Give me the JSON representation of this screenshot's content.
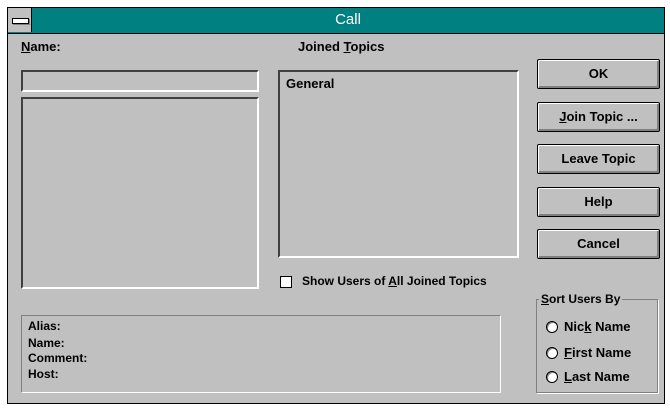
{
  "window": {
    "title": "Call"
  },
  "name_label": {
    "before": "",
    "key": "N",
    "after": "ame:"
  },
  "name_field": {
    "value": ""
  },
  "joined_topics_label": {
    "before": "Joined ",
    "key": "T",
    "after": "opics"
  },
  "joined_topics": [
    "General"
  ],
  "show_users_checkbox": {
    "before": "Show Users of ",
    "key": "A",
    "after": "ll Joined Topics",
    "checked": false
  },
  "buttons": {
    "ok": {
      "before": "",
      "key": "",
      "after": "OK"
    },
    "join_topic": {
      "before": "",
      "key": "J",
      "after": "oin Topic ..."
    },
    "leave_topic": {
      "before": "Leave Topic",
      "key": "",
      "after": ""
    },
    "help": {
      "before": "Help",
      "key": "",
      "after": ""
    },
    "cancel": {
      "before": "Cancel",
      "key": "",
      "after": ""
    }
  },
  "info_panel": {
    "alias": "Alias:",
    "name": "Name:",
    "comment": "Comment:",
    "host": "Host:"
  },
  "sort_group": {
    "title": {
      "before": "",
      "key": "S",
      "after": "ort Users By"
    },
    "options": [
      {
        "before": "Nic",
        "key": "k",
        "after": " Name",
        "selected": false
      },
      {
        "before": "",
        "key": "F",
        "after": "irst Name",
        "selected": false
      },
      {
        "before": "",
        "key": "L",
        "after": "ast Name",
        "selected": false
      }
    ]
  }
}
